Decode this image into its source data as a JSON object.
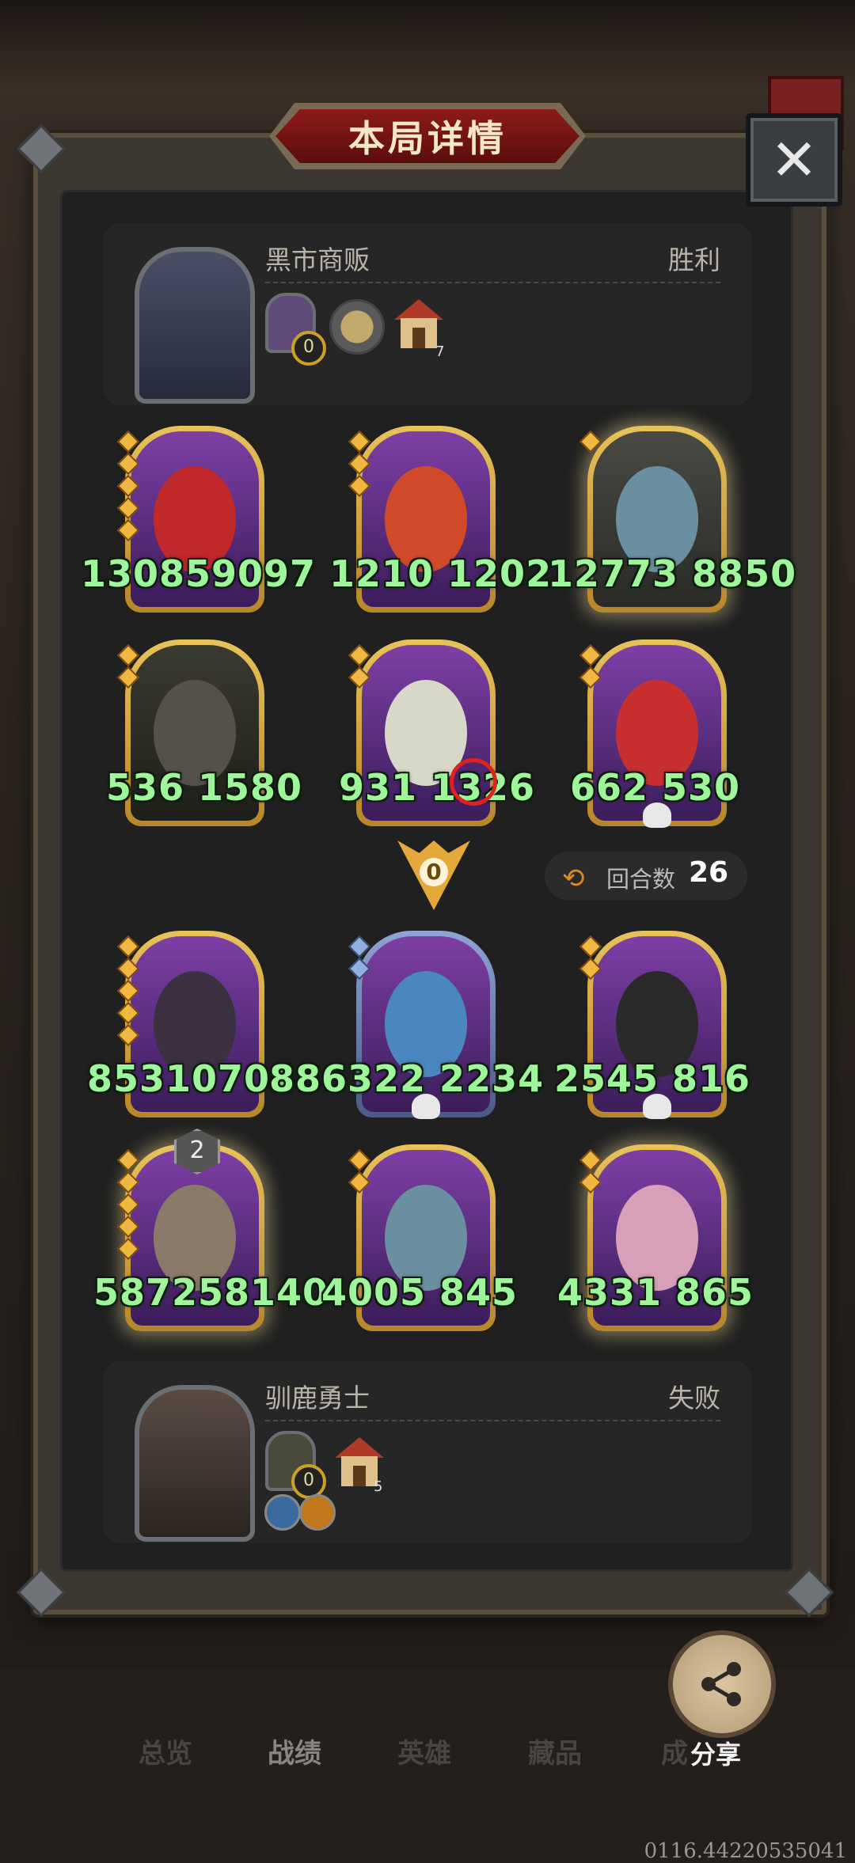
{
  "header": {
    "title": "本局详情",
    "close_glyph": "✕"
  },
  "top_player": {
    "name": "黑市商贩",
    "result": "胜利",
    "coin_count": "0",
    "house_level": "7"
  },
  "top_board": [
    {
      "stats": "130859097",
      "art": "red-dragon"
    },
    {
      "stats": "1210 1202",
      "art": "red-hair-girl"
    },
    {
      "stats": "12773 8850",
      "art": "bat-demon"
    },
    {
      "stats": "536 1580",
      "art": "dark-dragon"
    },
    {
      "stats": "931 1326",
      "art": "white-serpent"
    },
    {
      "stats": "662 530",
      "art": "red-wyvern"
    }
  ],
  "middle": {
    "arrow_count": "0",
    "rounds_label": "回合数",
    "rounds_value": "26"
  },
  "bottom_board": [
    {
      "stats": "85310704",
      "art": "dark-dragon"
    },
    {
      "stats": "886322 2234",
      "art": "blue-dragon"
    },
    {
      "stats": "2545 816",
      "art": "armored-knight"
    },
    {
      "stats": "587258140",
      "art": "viking-warrior",
      "level": "2"
    },
    {
      "stats": "4005 845",
      "art": "bat-demon"
    },
    {
      "stats": "4331 865",
      "art": "pink-warrior"
    }
  ],
  "bottom_player": {
    "name": "驯鹿勇士",
    "result": "失败",
    "coin_count": "0",
    "house_level": "5"
  },
  "nav": {
    "tabs": [
      "总览",
      "战绩",
      "英雄",
      "藏品",
      "成"
    ],
    "active": "战绩"
  },
  "share": {
    "label": "分享"
  },
  "version": "0116.44220535041",
  "colors": {
    "gold": "#e8c25a",
    "stat_green": "#9ff59a",
    "title_red": "#8e1a1a"
  }
}
